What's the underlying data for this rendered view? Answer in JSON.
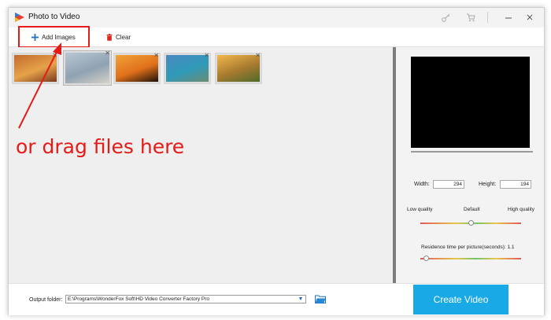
{
  "window": {
    "title": "Photo to Video"
  },
  "titlebar": {
    "icons": [
      "key-icon",
      "cart-icon",
      "minimize-icon",
      "close-icon"
    ]
  },
  "toolbar": {
    "add_label": "Add Images",
    "clear_label": "Clear"
  },
  "thumbnails": [
    {
      "name": "autumn-road-photo",
      "colors": [
        "#c26a2c",
        "#e6a34a",
        "#7a3b1c"
      ]
    },
    {
      "name": "person-sitting-mountain-photo",
      "colors": [
        "#b9c7d3",
        "#8fa2b3",
        "#d7d2c7"
      ]
    },
    {
      "name": "sunset-silhouette-photo",
      "colors": [
        "#f2a23a",
        "#e0701a",
        "#1d1208"
      ]
    },
    {
      "name": "mountain-lake-photo",
      "colors": [
        "#4a88c2",
        "#2f9ab8",
        "#6c8b74"
      ]
    },
    {
      "name": "sunrise-valley-photo",
      "colors": [
        "#f4b84c",
        "#a5792f",
        "#4f6b2a"
      ]
    }
  ],
  "preview": {
    "width_label": "Width:",
    "width_value": "294",
    "height_label": "Height:",
    "height_value": "194"
  },
  "quality": {
    "low_label": "Low quality",
    "default_label": "Default",
    "high_label": "High quality",
    "level": 0.5
  },
  "residence": {
    "label": "Residence time per picture(seconds): 1.1",
    "level": 0.06
  },
  "output": {
    "label": "Output folder:",
    "path": "E:\\Programs\\WonderFox Soft\\HD Video Converter Factory Pro"
  },
  "create_label": "Create Video",
  "annotation": {
    "text": "or drag files here",
    "color": "#e41b17"
  },
  "colors": {
    "accent": "#18a9e6",
    "add_icon": "#1e73be",
    "clear_icon": "#d9281e"
  }
}
